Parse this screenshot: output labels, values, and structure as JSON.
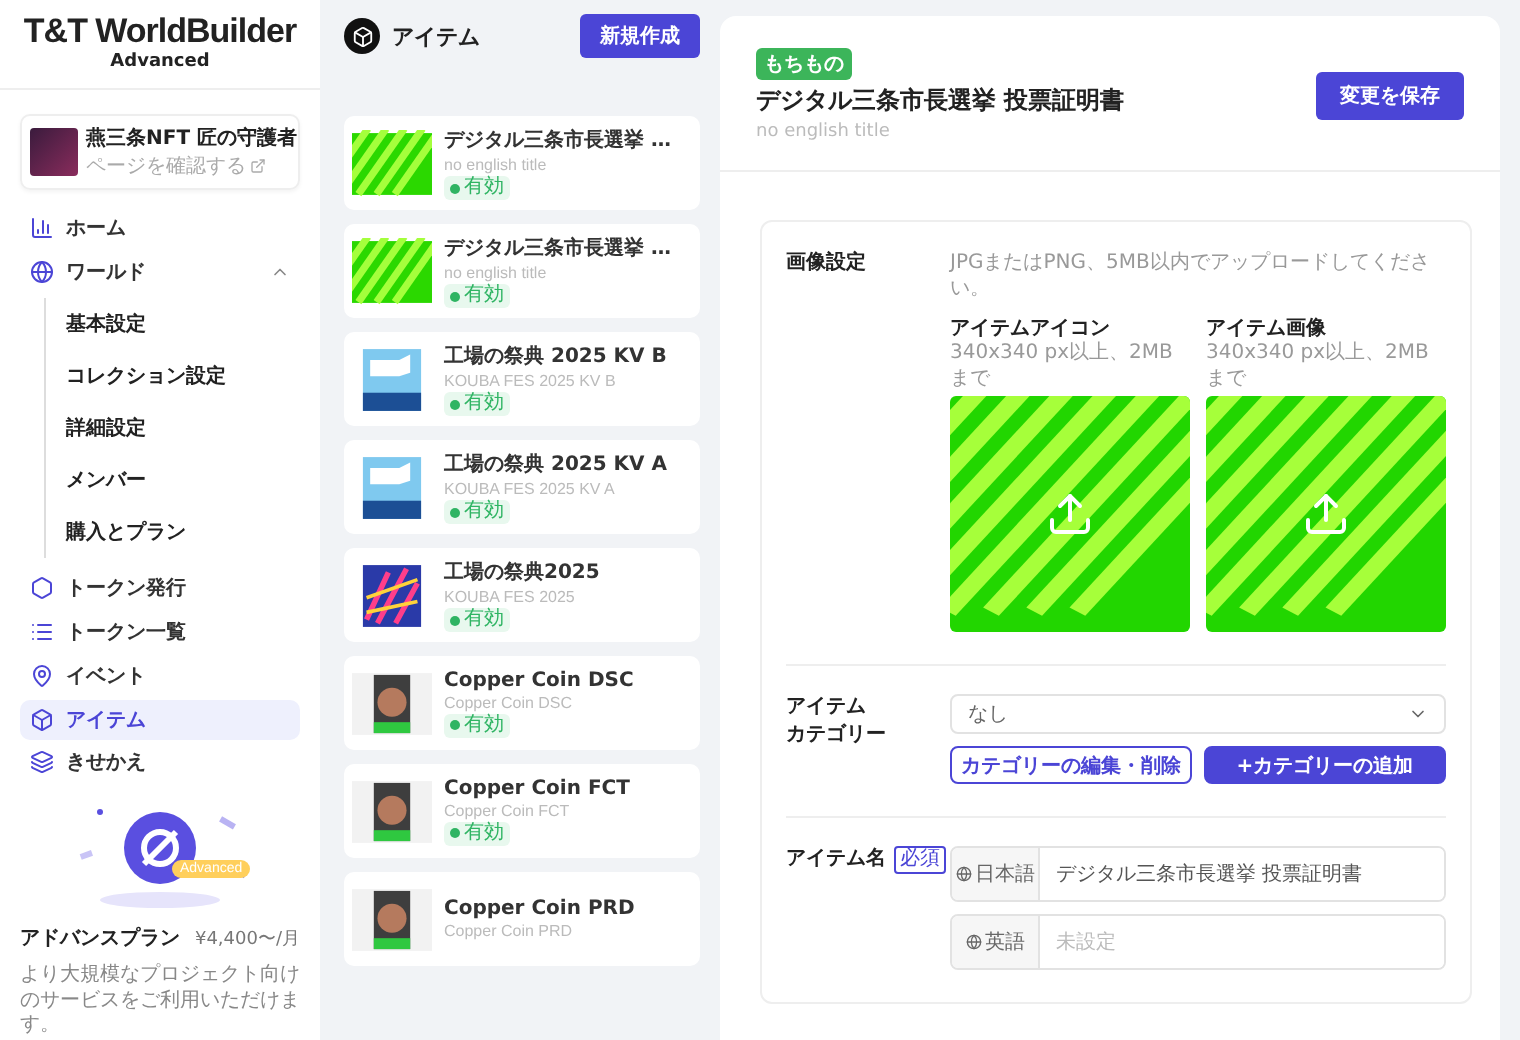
{
  "logo": {
    "name": "T&T WorldBuilder",
    "edition": "Advanced"
  },
  "project": {
    "title": "燕三条NFT 匠の守護者",
    "link": "ページを確認する"
  },
  "nav": [
    {
      "label": "ホーム",
      "selected": false
    },
    {
      "label": "ワールド",
      "selected": false,
      "expanded": true,
      "children": [
        {
          "label": "基本設定"
        },
        {
          "label": "コレクション設定"
        },
        {
          "label": "詳細設定"
        },
        {
          "label": "メンバー"
        },
        {
          "label": "購入とプラン"
        }
      ]
    },
    {
      "label": "トークン発行",
      "selected": false
    },
    {
      "label": "トークン一覧",
      "selected": false
    },
    {
      "label": "イベント",
      "selected": false
    },
    {
      "label": "アイテム",
      "selected": true
    },
    {
      "label": "きせかえ",
      "selected": false
    }
  ],
  "plan": {
    "badge": "Advanced",
    "name": "アドバンスプラン",
    "price": "¥4,400〜/月",
    "description": "より大規模なプロジェクト向けのサービスをご利用いただけます。"
  },
  "items_panel": {
    "title": "アイテム",
    "new_button": "新規作成"
  },
  "items": [
    {
      "title": "デジタル三条市長選挙 …",
      "subtitle": "no english title",
      "status": "有効",
      "kind": "green"
    },
    {
      "title": "デジタル三条市長選挙 …",
      "subtitle": "no english title",
      "status": "有効",
      "kind": "green"
    },
    {
      "title": "工場の祭典 2025 KV B",
      "subtitle": "KOUBA FES 2025 KV B",
      "status": "有効",
      "kind": "blue"
    },
    {
      "title": "工場の祭典 2025 KV A",
      "subtitle": "KOUBA FES 2025 KV A",
      "status": "有効",
      "kind": "blue"
    },
    {
      "title": "工場の祭典2025",
      "subtitle": "KOUBA FES 2025",
      "status": "有効",
      "kind": "colorful"
    },
    {
      "title": "Copper Coin DSC",
      "subtitle": "Copper Coin DSC",
      "status": "有効",
      "kind": "coin"
    },
    {
      "title": "Copper Coin FCT",
      "subtitle": "Copper Coin FCT",
      "status": "有効",
      "kind": "coin"
    },
    {
      "title": "Copper Coin PRD",
      "subtitle": "Copper Coin PRD",
      "kind": "coin"
    }
  ],
  "detail": {
    "tag": "もちもの",
    "title": "デジタル三条市長選挙 投票証明書",
    "subtitle": "no english title",
    "save_button": "変更を保存",
    "image_settings": {
      "label": "画像設定",
      "hint": "JPGまたはPNG、5MB以内でアップロードしてください。",
      "uploads": [
        {
          "label": "アイテムアイコン",
          "note": "340x340 px以上、2MBまで"
        },
        {
          "label": "アイテム画像",
          "note": "340x340 px以上、2MBまで"
        }
      ]
    },
    "category": {
      "label_lines": [
        "アイテム",
        "カテゴリー"
      ],
      "value": "なし",
      "edit_button": "カテゴリーの編集・削除",
      "add_button": "+カテゴリーの追加"
    },
    "name": {
      "label": "アイテム名",
      "required": "必須",
      "fields": [
        {
          "lang": "日本語",
          "value": "デジタル三条市長選挙 投票証明書"
        },
        {
          "lang": "英語",
          "placeholder": "未設定"
        }
      ]
    }
  }
}
